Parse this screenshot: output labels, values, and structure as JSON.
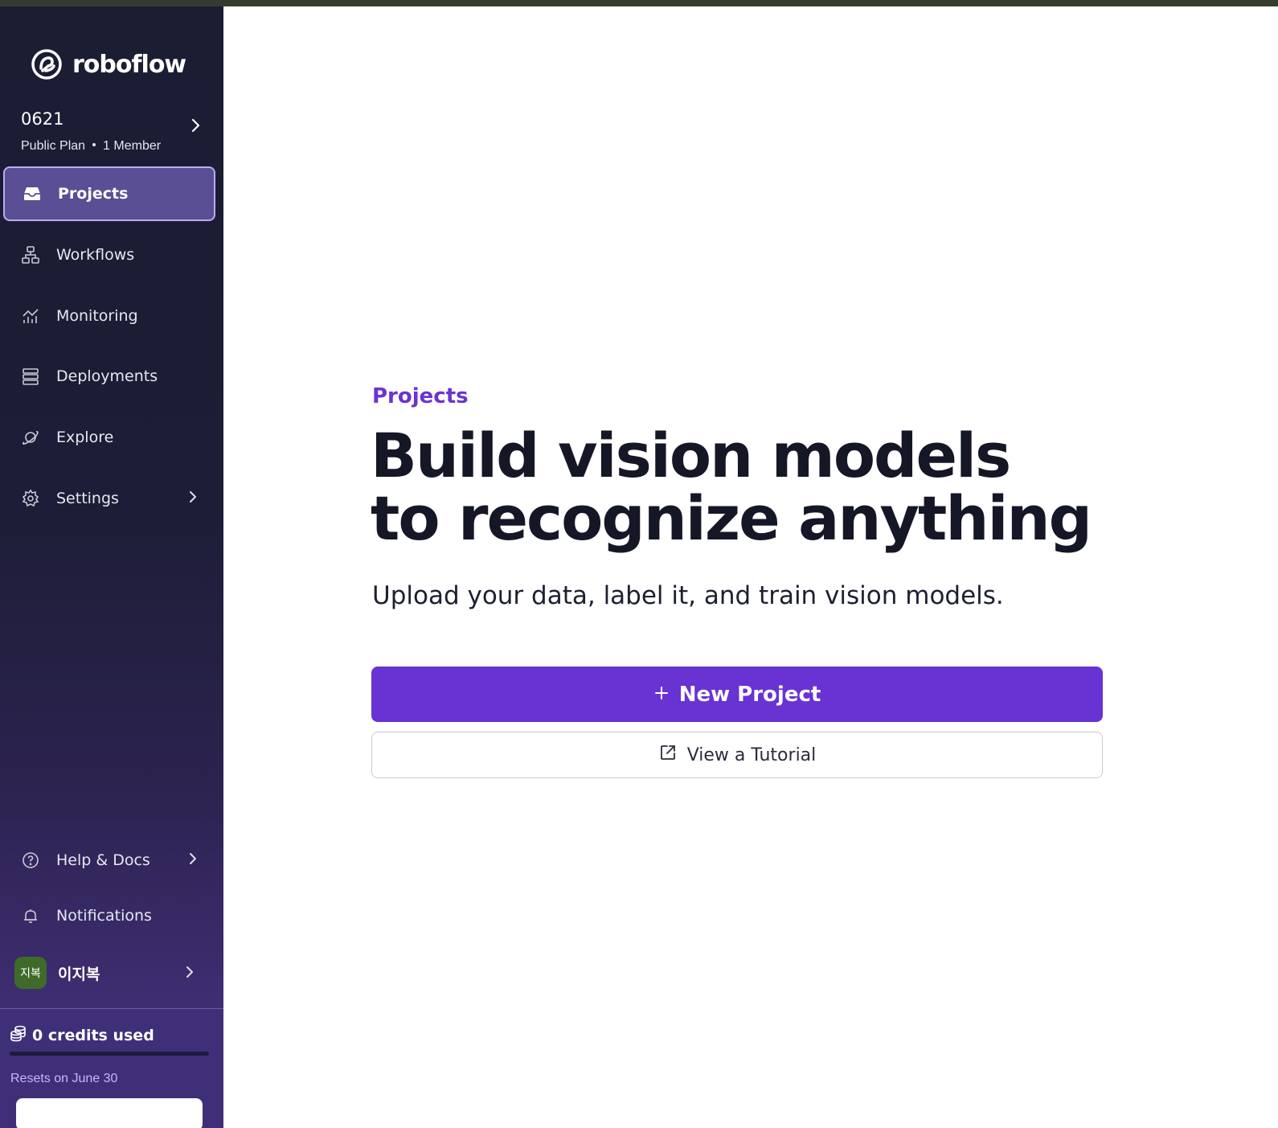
{
  "brand": {
    "name": "roboflow",
    "icon": "roboflow-logo-icon"
  },
  "workspace": {
    "name": "0621",
    "plan": "Public Plan",
    "members": "1 Member"
  },
  "sidebar": {
    "items": [
      {
        "label": "Projects",
        "icon": "inbox-icon",
        "active": true
      },
      {
        "label": "Workflows",
        "icon": "workflow-icon"
      },
      {
        "label": "Monitoring",
        "icon": "monitoring-icon"
      },
      {
        "label": "Deployments",
        "icon": "server-icon"
      },
      {
        "label": "Explore",
        "icon": "planet-icon"
      },
      {
        "label": "Settings",
        "icon": "gear-icon"
      }
    ],
    "bottom_items": [
      {
        "label": "Help & Docs",
        "icon": "help-icon"
      },
      {
        "label": "Notifications",
        "icon": "bell-icon"
      }
    ],
    "user": {
      "avatar_text": "지복",
      "name": "이지복"
    },
    "credits": {
      "label": "0 credits used",
      "reset": "Resets on June 30",
      "used_fraction": 0
    }
  },
  "main": {
    "eyebrow": "Projects",
    "headline": "Build vision models to recognize anything",
    "subtitle": "Upload your data, label it, and train vision models.",
    "primary_button": "New Project",
    "secondary_button": "View a Tutorial"
  },
  "colors": {
    "accent": "#6933d3",
    "eyebrow": "#6c33d0",
    "sidebar_bg": "#1b1d33",
    "avatar_bg": "#3f6b2a"
  }
}
